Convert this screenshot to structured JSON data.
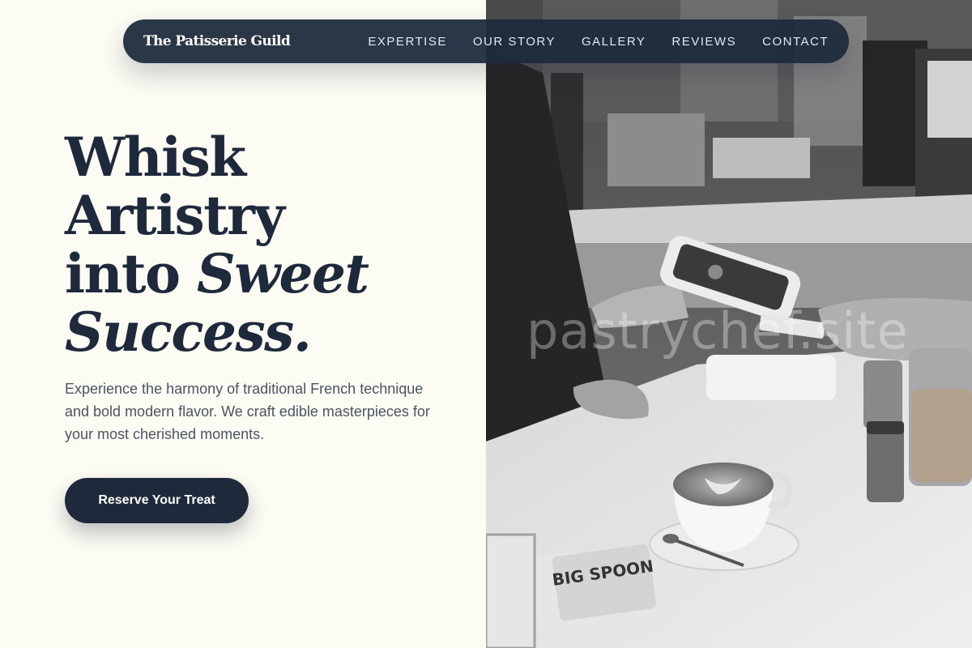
{
  "nav": {
    "brand": "The Patisserie Guild",
    "links": [
      "EXPERTISE",
      "OUR STORY",
      "GALLERY",
      "REVIEWS",
      "CONTACT"
    ]
  },
  "hero": {
    "title_line1": "Whisk",
    "title_line2": "Artistry",
    "title_line3_plain": "into ",
    "title_line3_italic": "Sweet",
    "title_line4_italic": "Success.",
    "subtitle": "Experience the harmony of traditional French technique and bold modern flavor. We craft edible masterpieces for your most cherished moments.",
    "cta_label": "Reserve Your Treat"
  },
  "image": {
    "watermark": "pastrychef.site",
    "package_text": "BIG SPOON"
  },
  "colors": {
    "background": "#fcfbf4",
    "navy": "#1e293b",
    "body_text": "#4b5563"
  }
}
